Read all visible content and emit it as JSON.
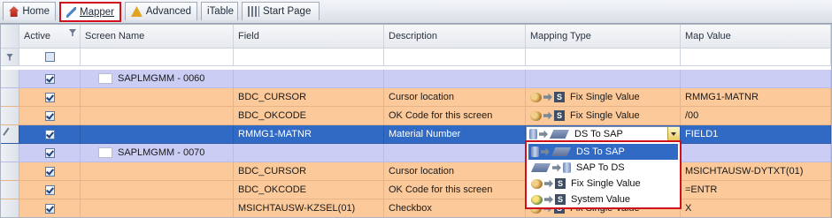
{
  "tabs": [
    {
      "label": "Home",
      "icon": "home-icon"
    },
    {
      "label": "Mapper",
      "icon": "mapper-icon"
    },
    {
      "label": "Advanced",
      "icon": "advanced-icon"
    },
    {
      "label": "iTable",
      "icon": ""
    },
    {
      "label": "Start Page",
      "icon": "start-page-icon"
    }
  ],
  "columns": [
    "Active",
    "Screen Name",
    "Field",
    "Description",
    "Mapping Type",
    "Map Value"
  ],
  "rows": [
    {
      "kind": "group",
      "active": true,
      "screen": "SAPLMGMM - 0060",
      "field": "",
      "desc": "",
      "type": "",
      "value": ""
    },
    {
      "kind": "data",
      "active": true,
      "screen": "",
      "field": "BDC_CURSOR",
      "desc": "Cursor location",
      "type": "Fix Single Value",
      "value": "RMMG1-MATNR"
    },
    {
      "kind": "data",
      "active": true,
      "screen": "",
      "field": "BDC_OKCODE",
      "desc": "OK Code for this screen",
      "type": "Fix Single Value",
      "value": "/00"
    },
    {
      "kind": "selected",
      "active": true,
      "screen": "",
      "field": "RMMG1-MATNR",
      "desc": "Material Number",
      "type": "DS To SAP",
      "value": "FIELD1"
    },
    {
      "kind": "group",
      "active": true,
      "screen": "SAPLMGMM - 0070",
      "field": "",
      "desc": "",
      "type": "",
      "value": ""
    },
    {
      "kind": "data",
      "active": true,
      "screen": "",
      "field": "BDC_CURSOR",
      "desc": "Cursor location",
      "type": "",
      "value": "MSICHTAUSW-DYTXT(01)"
    },
    {
      "kind": "data",
      "active": true,
      "screen": "",
      "field": "BDC_OKCODE",
      "desc": "OK Code for this screen",
      "type": "",
      "value": "=ENTR"
    },
    {
      "kind": "data",
      "active": true,
      "screen": "",
      "field": "MSICHTAUSW-KZSEL(01)",
      "desc": "Checkbox",
      "type": "Fix Single Value",
      "value": "X"
    }
  ],
  "dropdown": {
    "options": [
      "DS To SAP",
      "SAP To DS",
      "Fix Single Value",
      "System Value"
    ],
    "selected": "DS To SAP"
  },
  "colors": {
    "group_row": "#cbcdf5",
    "data_row": "#fcc99a",
    "selected_row": "#316ac5",
    "highlight_border": "#d0101a"
  }
}
